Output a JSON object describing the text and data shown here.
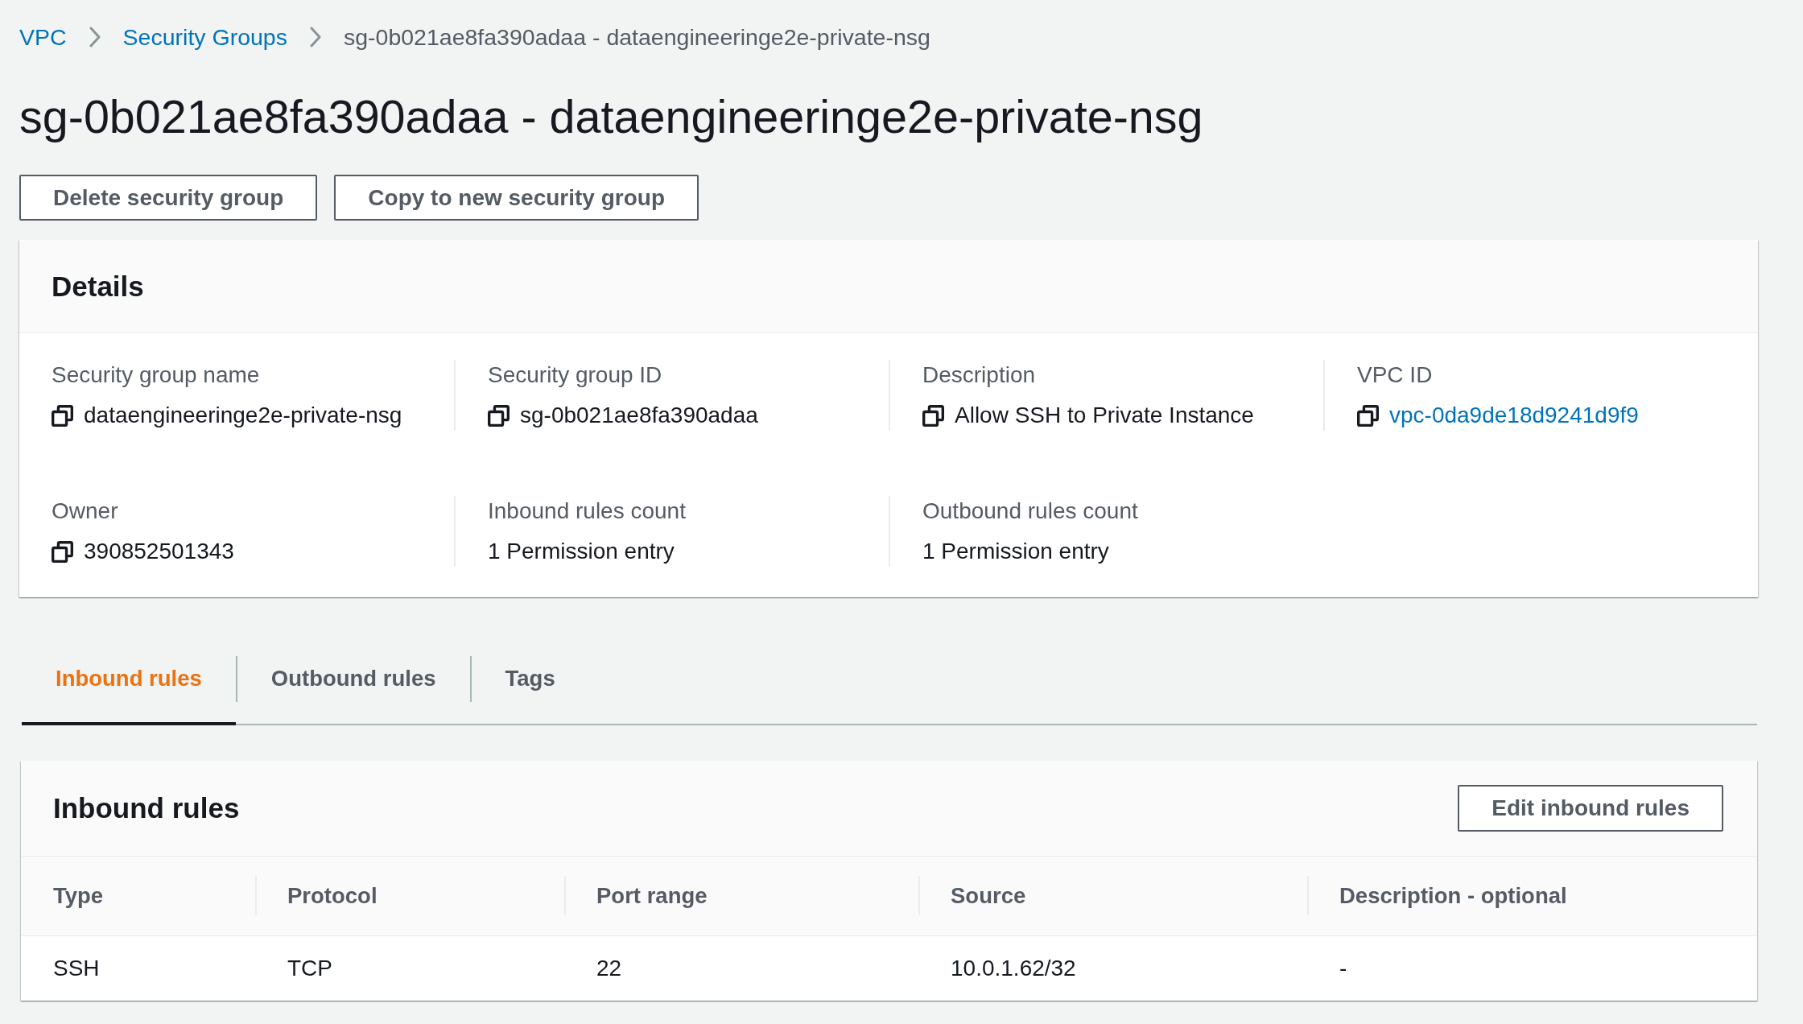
{
  "breadcrumb": [
    {
      "label": "VPC",
      "kind": "link"
    },
    {
      "label": "Security Groups",
      "kind": "link"
    },
    {
      "label": "sg-0b021ae8fa390adaa - dataengineeringe2e-private-nsg",
      "kind": "current"
    }
  ],
  "title": "sg-0b021ae8fa390adaa - dataengineeringe2e-private-nsg",
  "actions": [
    "Delete security group",
    "Copy to new security group"
  ],
  "details": {
    "title": "Details",
    "rows": [
      [
        {
          "label": "Security group name",
          "value": "dataengineeringe2e-private-nsg",
          "kind": "text",
          "copyable": true
        },
        {
          "label": "Security group ID",
          "value": "sg-0b021ae8fa390adaa",
          "kind": "text",
          "copyable": true
        },
        {
          "label": "Description",
          "value": "Allow SSH to Private Instance",
          "kind": "text",
          "copyable": true
        },
        {
          "label": "VPC ID",
          "value": "vpc-0da9de18d9241d9f9",
          "kind": "link",
          "copyable": true
        }
      ],
      [
        {
          "label": "Owner",
          "value": "390852501343",
          "kind": "text",
          "copyable": true
        },
        {
          "label": "Inbound rules count",
          "value": "1 Permission entry",
          "kind": "text",
          "copyable": false
        },
        {
          "label": "Outbound rules count",
          "value": "1 Permission entry",
          "kind": "text",
          "copyable": false
        }
      ]
    ]
  },
  "tabs": [
    {
      "label": "Inbound rules",
      "selected": true
    },
    {
      "label": "Outbound rules",
      "selected": false
    },
    {
      "label": "Tags",
      "selected": false
    }
  ],
  "inbound_rules": {
    "title": "Inbound rules",
    "button": "Edit inbound rules",
    "columns": [
      "Type",
      "Protocol",
      "Port range",
      "Source",
      "Description - optional"
    ],
    "rows": [
      [
        "SSH",
        "TCP",
        "22",
        "10.0.1.62/32",
        "-"
      ]
    ]
  }
}
